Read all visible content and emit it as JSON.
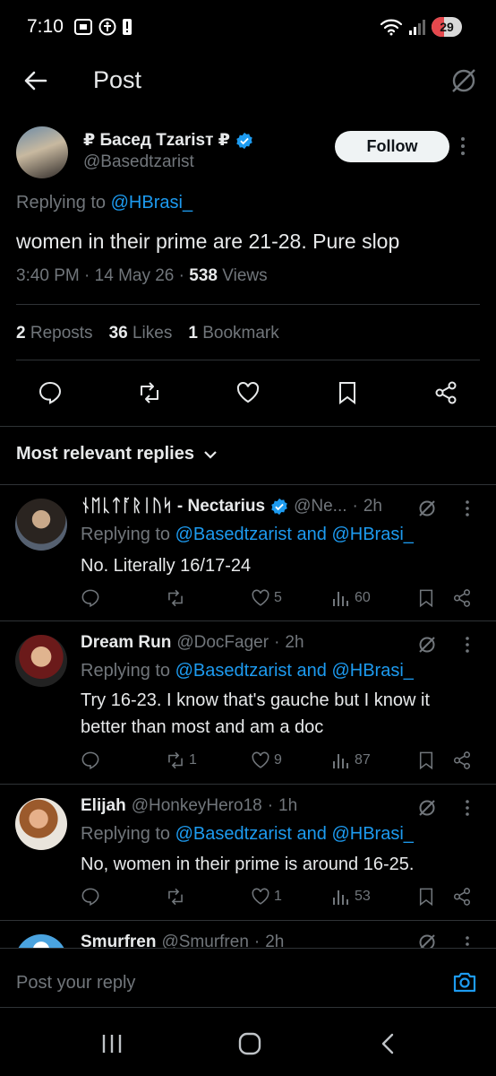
{
  "status_bar": {
    "time": "7:10",
    "battery": "29"
  },
  "header": {
    "title": "Post"
  },
  "post": {
    "author_name": "₽ Басед Tzarisт ₽",
    "author_handle": "@Basedtzarist",
    "follow_label": "Follow",
    "replying_prefix": "Replying to",
    "replying_to": "@HBrasi_",
    "text": "women in their prime are 21-28. Pure slop",
    "time": "3:40 PM",
    "date": "14 May 26",
    "views_count": "538",
    "views_label": "Views",
    "reposts_count": "2",
    "reposts_label": "Reposts",
    "likes_count": "36",
    "likes_label": "Likes",
    "bookmarks_count": "1",
    "bookmarks_label": "Bookmark"
  },
  "replies_sort_label": "Most relevant replies",
  "replies": [
    {
      "name": "ᚾᛖᚳᛏᚪᚱᛁᚢᛋ - Nectarius",
      "handle": "@Ne...",
      "time": "2h",
      "replying_prefix": "Replying to",
      "replying_to": "@Basedtzarist and @HBrasi_",
      "text": "No. Literally 16/17-24",
      "reposts": "",
      "likes": "5",
      "views": "60",
      "verified": true
    },
    {
      "name": "Dream Run",
      "handle": "@DocFager",
      "time": "2h",
      "replying_prefix": "Replying to",
      "replying_to": "@Basedtzarist and @HBrasi_",
      "text": "Try 16-23. I know that's gauche but I know it better than most and am a doc",
      "reposts": "1",
      "likes": "9",
      "views": "87",
      "verified": false
    },
    {
      "name": "Elijah",
      "handle": "@HonkeyHero18",
      "time": "1h",
      "replying_prefix": "Replying to",
      "replying_to": "@Basedtzarist and @HBrasi_",
      "text": "No, women in their prime is around 16-25.",
      "reposts": "",
      "likes": "1",
      "views": "53",
      "verified": false
    },
    {
      "name": "Smurfren",
      "handle": "@Smurfren",
      "time": "2h"
    }
  ],
  "composer": {
    "placeholder": "Post your reply"
  },
  "colors": {
    "accent": "#1d9bf0",
    "muted": "#71767b",
    "divider": "#2f3336"
  }
}
